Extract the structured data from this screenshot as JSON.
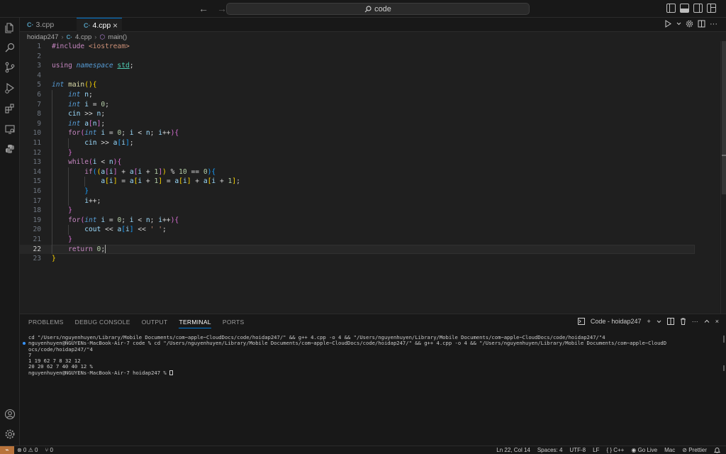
{
  "titlebar": {
    "search_text": "code",
    "back_icon": "←",
    "forward_icon": "→"
  },
  "tabs": [
    {
      "label": "3.cpp",
      "icon": "C·",
      "active": false
    },
    {
      "label": "4.cpp",
      "icon": "C·",
      "active": true
    }
  ],
  "breadcrumb": {
    "folder": "hoidap247",
    "file": "4.cpp",
    "symbol": "main()",
    "separator": "›"
  },
  "code_lines": [
    {
      "n": "1",
      "indent": 0,
      "tokens": [
        [
          "pre",
          "#include "
        ],
        [
          "inc",
          "<iostream>"
        ]
      ]
    },
    {
      "n": "2",
      "indent": 0,
      "tokens": []
    },
    {
      "n": "3",
      "indent": 0,
      "tokens": [
        [
          "ctl",
          "using "
        ],
        [
          "kw",
          "namespace "
        ],
        [
          "ns",
          "std"
        ],
        [
          "op",
          ";"
        ]
      ]
    },
    {
      "n": "4",
      "indent": 0,
      "tokens": []
    },
    {
      "n": "5",
      "indent": 0,
      "tokens": [
        [
          "kw",
          "int "
        ],
        [
          "fn",
          "main"
        ],
        [
          "b1",
          "()"
        ],
        [
          "b1",
          "{"
        ]
      ]
    },
    {
      "n": "6",
      "indent": 1,
      "tokens": [
        [
          "kw",
          "int "
        ],
        [
          "var",
          "n"
        ],
        [
          "op",
          ";"
        ]
      ]
    },
    {
      "n": "7",
      "indent": 1,
      "tokens": [
        [
          "kw",
          "int "
        ],
        [
          "var",
          "i"
        ],
        [
          "op",
          " = "
        ],
        [
          "num",
          "0"
        ],
        [
          "op",
          ";"
        ]
      ]
    },
    {
      "n": "8",
      "indent": 1,
      "tokens": [
        [
          "var",
          "cin"
        ],
        [
          "op",
          " >> "
        ],
        [
          "var",
          "n"
        ],
        [
          "op",
          ";"
        ]
      ]
    },
    {
      "n": "9",
      "indent": 1,
      "tokens": [
        [
          "kw",
          "int "
        ],
        [
          "var",
          "a"
        ],
        [
          "b2",
          "["
        ],
        [
          "var",
          "n"
        ],
        [
          "b2",
          "]"
        ],
        [
          "op",
          ";"
        ]
      ]
    },
    {
      "n": "10",
      "indent": 1,
      "tokens": [
        [
          "ctl",
          "for"
        ],
        [
          "b2",
          "("
        ],
        [
          "kw",
          "int "
        ],
        [
          "var",
          "i"
        ],
        [
          "op",
          " = "
        ],
        [
          "num",
          "0"
        ],
        [
          "op",
          "; "
        ],
        [
          "var",
          "i"
        ],
        [
          "op",
          " < "
        ],
        [
          "var",
          "n"
        ],
        [
          "op",
          "; "
        ],
        [
          "var",
          "i"
        ],
        [
          "op",
          "++"
        ],
        [
          "b2",
          ")"
        ],
        [
          "b2",
          "{"
        ]
      ]
    },
    {
      "n": "11",
      "indent": 2,
      "tokens": [
        [
          "var",
          "cin"
        ],
        [
          "op",
          " >> "
        ],
        [
          "var",
          "a"
        ],
        [
          "b3",
          "["
        ],
        [
          "var",
          "i"
        ],
        [
          "b3",
          "]"
        ],
        [
          "op",
          ";"
        ]
      ]
    },
    {
      "n": "12",
      "indent": 1,
      "tokens": [
        [
          "b2",
          "}"
        ]
      ]
    },
    {
      "n": "13",
      "indent": 1,
      "tokens": [
        [
          "ctl",
          "while"
        ],
        [
          "b2",
          "("
        ],
        [
          "var",
          "i"
        ],
        [
          "op",
          " < "
        ],
        [
          "var",
          "n"
        ],
        [
          "b2",
          ")"
        ],
        [
          "b2",
          "{"
        ]
      ]
    },
    {
      "n": "14",
      "indent": 2,
      "tokens": [
        [
          "ctl",
          "if"
        ],
        [
          "b3",
          "("
        ],
        [
          "b1",
          "("
        ],
        [
          "var",
          "a"
        ],
        [
          "b2",
          "["
        ],
        [
          "var",
          "i"
        ],
        [
          "b2",
          "]"
        ],
        [
          "op",
          " + "
        ],
        [
          "var",
          "a"
        ],
        [
          "b2",
          "["
        ],
        [
          "var",
          "i"
        ],
        [
          "op",
          " + "
        ],
        [
          "num",
          "1"
        ],
        [
          "b2",
          "]"
        ],
        [
          "b1",
          ")"
        ],
        [
          "op",
          " % "
        ],
        [
          "num",
          "10"
        ],
        [
          "op",
          " == "
        ],
        [
          "num",
          "0"
        ],
        [
          "b3",
          ")"
        ],
        [
          "b3",
          "{"
        ]
      ]
    },
    {
      "n": "15",
      "indent": 3,
      "tokens": [
        [
          "var",
          "a"
        ],
        [
          "b1",
          "["
        ],
        [
          "var",
          "i"
        ],
        [
          "b1",
          "]"
        ],
        [
          "op",
          " = "
        ],
        [
          "var",
          "a"
        ],
        [
          "b1",
          "["
        ],
        [
          "var",
          "i"
        ],
        [
          "op",
          " + "
        ],
        [
          "num",
          "1"
        ],
        [
          "b1",
          "]"
        ],
        [
          "op",
          " = "
        ],
        [
          "var",
          "a"
        ],
        [
          "b1",
          "["
        ],
        [
          "var",
          "i"
        ],
        [
          "b1",
          "]"
        ],
        [
          "op",
          " + "
        ],
        [
          "var",
          "a"
        ],
        [
          "b1",
          "["
        ],
        [
          "var",
          "i"
        ],
        [
          "op",
          " + "
        ],
        [
          "num",
          "1"
        ],
        [
          "b1",
          "]"
        ],
        [
          "op",
          ";"
        ]
      ]
    },
    {
      "n": "16",
      "indent": 2,
      "tokens": [
        [
          "b3",
          "}"
        ]
      ]
    },
    {
      "n": "17",
      "indent": 2,
      "tokens": [
        [
          "var",
          "i"
        ],
        [
          "op",
          "++"
        ],
        [
          "op",
          ";"
        ]
      ]
    },
    {
      "n": "18",
      "indent": 1,
      "tokens": [
        [
          "b2",
          "}"
        ]
      ]
    },
    {
      "n": "19",
      "indent": 1,
      "tokens": [
        [
          "ctl",
          "for"
        ],
        [
          "b2",
          "("
        ],
        [
          "kw",
          "int "
        ],
        [
          "var",
          "i"
        ],
        [
          "op",
          " = "
        ],
        [
          "num",
          "0"
        ],
        [
          "op",
          "; "
        ],
        [
          "var",
          "i"
        ],
        [
          "op",
          " < "
        ],
        [
          "var",
          "n"
        ],
        [
          "op",
          "; "
        ],
        [
          "var",
          "i"
        ],
        [
          "op",
          "++"
        ],
        [
          "b2",
          ")"
        ],
        [
          "b2",
          "{"
        ]
      ]
    },
    {
      "n": "20",
      "indent": 2,
      "tokens": [
        [
          "var",
          "cout"
        ],
        [
          "op",
          " << "
        ],
        [
          "var",
          "a"
        ],
        [
          "b3",
          "["
        ],
        [
          "var",
          "i"
        ],
        [
          "b3",
          "]"
        ],
        [
          "op",
          " << "
        ],
        [
          "str",
          "' '"
        ],
        [
          "op",
          ";"
        ]
      ]
    },
    {
      "n": "21",
      "indent": 1,
      "tokens": [
        [
          "b2",
          "}"
        ]
      ]
    },
    {
      "n": "22",
      "indent": 1,
      "current": true,
      "tokens": [
        [
          "ctl",
          "return "
        ],
        [
          "num",
          "0"
        ],
        [
          "op",
          ";"
        ]
      ]
    },
    {
      "n": "23",
      "indent": 0,
      "tokens": [
        [
          "b1",
          "}"
        ]
      ]
    }
  ],
  "panel": {
    "tabs": [
      "PROBLEMS",
      "DEBUG CONSOLE",
      "OUTPUT",
      "TERMINAL",
      "PORTS"
    ],
    "active_tab": "TERMINAL",
    "terminal_name": "Code - hoidap247"
  },
  "terminal_lines": [
    {
      "text": "cd \"/Users/nguyenhuyen/Library/Mobile Documents/com~apple~CloudDocs/code/hoidap247/\" && g++ 4.cpp -o 4 && \"/Users/nguyenhuyen/Library/Mobile Documents/com~apple~CloudDocs/code/hoidap247/\"4",
      "dot": false
    },
    {
      "text": "nguyenhuyen@NGUYENs-MacBook-Air-7 code % cd \"/Users/nguyenhuyen/Library/Mobile Documents/com~apple~CloudDocs/code/hoidap247/\" && g++ 4.cpp -o 4 && \"/Users/nguyenhuyen/Library/Mobile Documents/com~apple~CloudD",
      "dot": true
    },
    {
      "text": "ocs/code/hoidap247/\"4",
      "dot": false
    },
    {
      "text": "7",
      "dot": false
    },
    {
      "text": "1 19 62 7 8 32 12",
      "dot": false
    },
    {
      "text": "20 20 62 7 40 40 12 %",
      "dot": false
    },
    {
      "text": "nguyenhuyen@NGUYENs-MacBook-Air-7 hoidap247 % ",
      "dot": false,
      "cursor": true
    }
  ],
  "statusbar": {
    "remote_icon": "⌁",
    "errors": "⊗ 0",
    "warnings": "⚠ 0",
    "ports": "⑂ 0",
    "position": "Ln 22, Col 14",
    "spaces": "Spaces: 4",
    "encoding": "UTF-8",
    "eol": "LF",
    "language": "{ } C++",
    "golive": "Go Live",
    "platform": "Mac",
    "prettier": "Prettier"
  }
}
